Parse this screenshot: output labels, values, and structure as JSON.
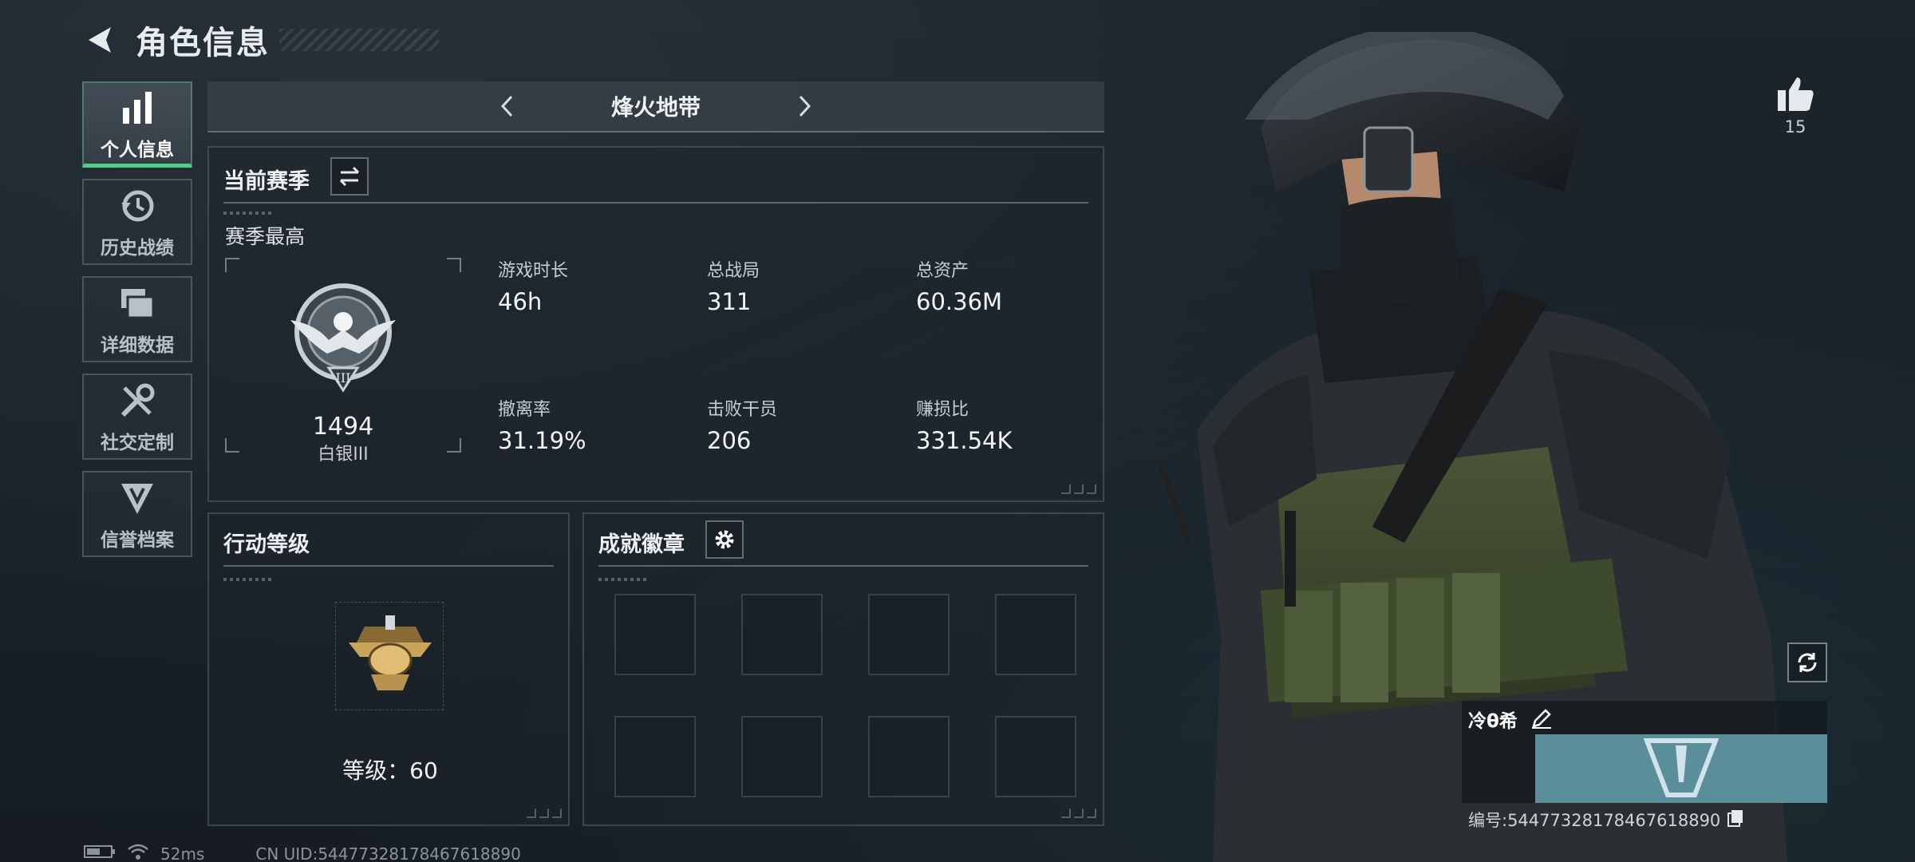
{
  "header": {
    "title": "角色信息"
  },
  "nav": {
    "items": [
      {
        "label": "个人信息",
        "icon": "bar-chart-icon"
      },
      {
        "label": "历史战绩",
        "icon": "history-icon"
      },
      {
        "label": "详细数据",
        "icon": "folders-icon"
      },
      {
        "label": "社交定制",
        "icon": "tools-icon"
      },
      {
        "label": "信誉档案",
        "icon": "shield-icon"
      }
    ]
  },
  "mode": {
    "name": "烽火地带"
  },
  "season": {
    "title": "当前赛季",
    "subtitle": "赛季最高",
    "rank_score": "1494",
    "rank_name": "白银III",
    "rank_numeral": "III",
    "stats": [
      {
        "label": "游戏时长",
        "value": "46h"
      },
      {
        "label": "总战局",
        "value": "311"
      },
      {
        "label": "总资产",
        "value": "60.36M"
      },
      {
        "label": "撤离率",
        "value": "31.19%"
      },
      {
        "label": "击败干员",
        "value": "206"
      },
      {
        "label": "赚损比",
        "value": "331.54K"
      }
    ]
  },
  "action_level": {
    "title": "行动等级",
    "level_text": "等级：60"
  },
  "achievements": {
    "title": "成就徽章"
  },
  "profile": {
    "likes": "15",
    "player_name": "冷θ希",
    "player_id": "编号:5447732817846761889​0"
  },
  "footer": {
    "ping": "52ms",
    "uid": "CN UID:544773281784676188​90"
  },
  "colors": {
    "accent": "#4bd08a",
    "plate": "#5b8e9b"
  }
}
